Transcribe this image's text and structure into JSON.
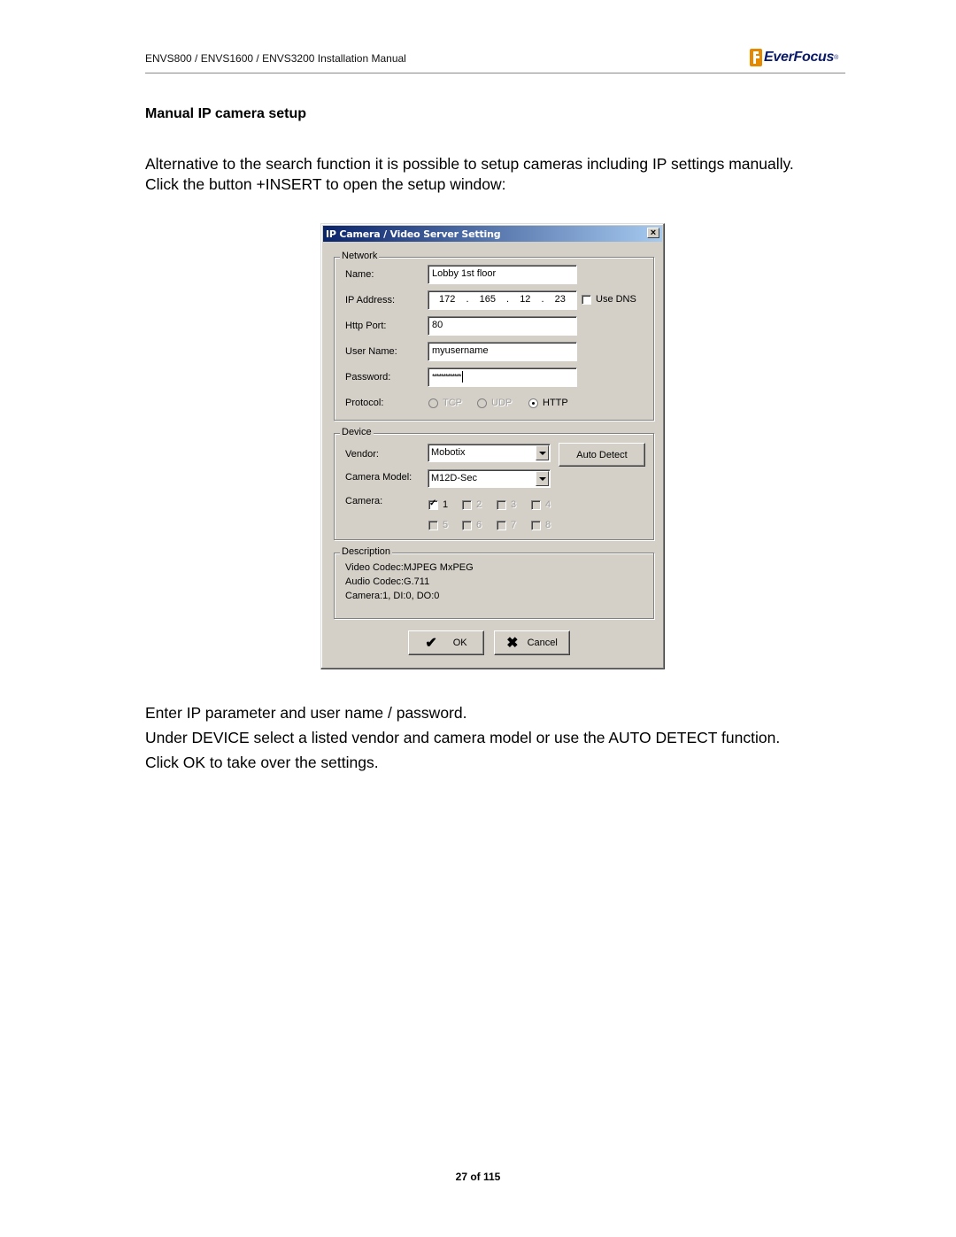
{
  "header": {
    "title": "ENVS800 / ENVS1600 / ENVS3200 Installation Manual",
    "logo_text": "EverFocus",
    "logo_reg": "®",
    "logo_color": "#e58a00"
  },
  "section_title": "Manual IP camera setup",
  "intro": "Alternative to the search function it is possible to setup cameras including IP settings manually.  Click the button  +INSERT to open the setup window:",
  "dialog": {
    "title": "IP Camera / Video Server Setting",
    "close_glyph": "×",
    "network": {
      "group_label": "Network",
      "name_label": "Name:",
      "name_value": "Lobby 1st floor",
      "ip_label": "IP Address:",
      "ip_octets": [
        "172",
        "165",
        "12",
        "23"
      ],
      "ip_sep": ".",
      "use_dns_label": "Use DNS",
      "use_dns_checked": false,
      "port_label": "Http Port:",
      "port_value": "80",
      "user_label": "User Name:",
      "user_value": "myusername",
      "password_label": "Password:",
      "password_value": "*************",
      "protocol_label": "Protocol:",
      "protocols": [
        {
          "label": "TCP",
          "selected": false,
          "enabled": false
        },
        {
          "label": "UDP",
          "selected": false,
          "enabled": false
        },
        {
          "label": "HTTP",
          "selected": true,
          "enabled": true
        }
      ]
    },
    "device": {
      "group_label": "Device",
      "vendor_label": "Vendor:",
      "vendor_value": "Mobotix",
      "auto_detect_label": "Auto Detect",
      "model_label": "Camera Model:",
      "model_value": "M12D-Sec",
      "camera_label": "Camera:",
      "cameras": [
        {
          "label": "1",
          "checked": true,
          "enabled": true
        },
        {
          "label": "2",
          "checked": false,
          "enabled": false
        },
        {
          "label": "3",
          "checked": false,
          "enabled": false
        },
        {
          "label": "4",
          "checked": false,
          "enabled": false
        },
        {
          "label": "5",
          "checked": false,
          "enabled": false
        },
        {
          "label": "6",
          "checked": false,
          "enabled": false
        },
        {
          "label": "7",
          "checked": false,
          "enabled": false
        },
        {
          "label": "8",
          "checked": false,
          "enabled": false
        }
      ]
    },
    "description": {
      "group_label": "Description",
      "lines": [
        "Video Codec:MJPEG MxPEG",
        "Audio Codec:G.711",
        "Camera:1, DI:0, DO:0"
      ]
    },
    "ok_label": "OK",
    "ok_icon": "✔",
    "cancel_label": "Cancel",
    "cancel_icon": "✖"
  },
  "body_lines": [
    "Enter IP parameter and user name / password.",
    "Under DEVICE select a listed vendor and camera model or use the AUTO DETECT function.",
    "Click OK to take over the settings."
  ],
  "footer": {
    "page_label": "27 of 115"
  }
}
